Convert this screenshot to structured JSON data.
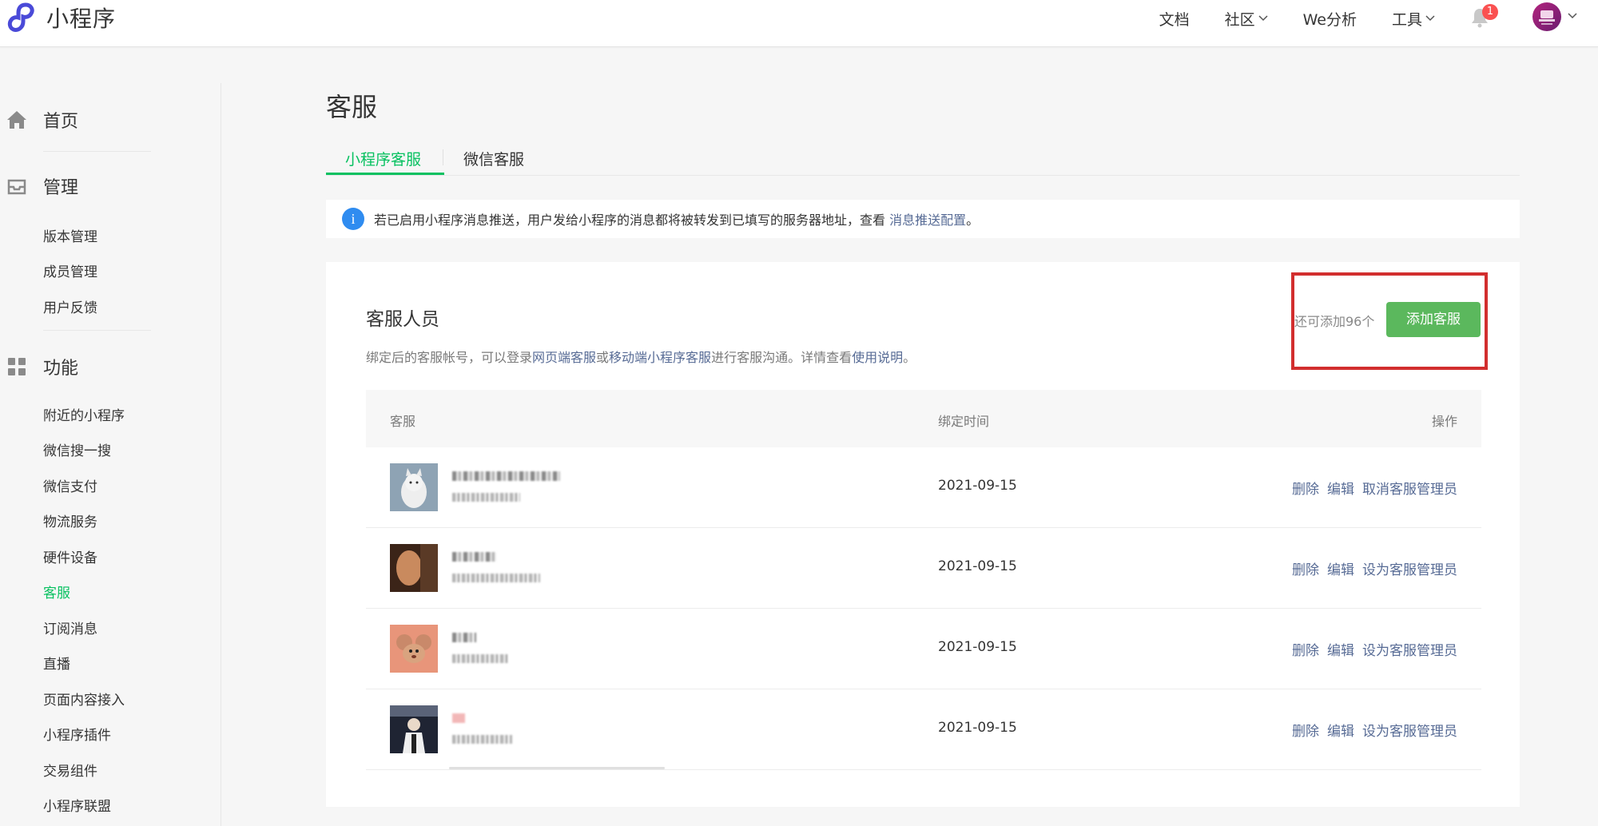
{
  "app": {
    "title": "小程序",
    "accent_color": "#07c160",
    "logo_icon": "miniprogram-logo-icon"
  },
  "topnav": {
    "items": [
      {
        "label": "文档",
        "has_dropdown": false
      },
      {
        "label": "社区",
        "has_dropdown": true
      },
      {
        "label": "We分析",
        "has_dropdown": false
      },
      {
        "label": "工具",
        "has_dropdown": true
      }
    ],
    "notification_count": "1",
    "bell_icon": "bell-icon",
    "avatar_icon": "user-avatar"
  },
  "sidebar": {
    "home": {
      "label": "首页",
      "icon": "home-icon"
    },
    "manage": {
      "label": "管理",
      "icon": "inbox-icon",
      "items": [
        "版本管理",
        "成员管理",
        "用户反馈"
      ]
    },
    "features": {
      "label": "功能",
      "icon": "grid-icon",
      "items": [
        "附近的小程序",
        "微信搜一搜",
        "微信支付",
        "物流服务",
        "硬件设备",
        "客服",
        "订阅消息",
        "直播",
        "页面内容接入",
        "小程序插件",
        "交易组件",
        "小程序联盟"
      ],
      "active": "客服"
    }
  },
  "page": {
    "title": "客服",
    "tabs": [
      {
        "label": "小程序客服",
        "active": true
      },
      {
        "label": "微信客服",
        "active": false
      }
    ],
    "notice": {
      "icon": "info-icon",
      "text": "若已启用小程序消息推送，用户发给小程序的消息都将被转发到已填写的服务器地址，查看 ",
      "link": "消息推送配置",
      "suffix": "。"
    },
    "card": {
      "title": "客服人员",
      "desc_prefix": "绑定后的客服帐号，可以登录",
      "desc_link1": "网页端客服",
      "desc_mid1": "或",
      "desc_link2": "移动端小程序客服",
      "desc_mid2": "进行客服沟通。详情查看",
      "desc_link3": "使用说明",
      "desc_suffix": "。",
      "quota": "还可添加96个",
      "add_button": "添加客服"
    },
    "table": {
      "headers": [
        "客服",
        "绑定时间",
        "操作"
      ],
      "rows": [
        {
          "avatar": "cat-avatar",
          "bind_time": "2021-09-15",
          "ops": [
            "删除",
            "编辑",
            "取消客服管理员"
          ]
        },
        {
          "avatar": "photo-avatar",
          "bind_time": "2021-09-15",
          "ops": [
            "删除",
            "编辑",
            "设为客服管理员"
          ]
        },
        {
          "avatar": "cartoon-mouse-avatar",
          "bind_time": "2021-09-15",
          "ops": [
            "删除",
            "编辑",
            "设为客服管理员"
          ]
        },
        {
          "avatar": "person-avatar",
          "bind_time": "2021-09-15",
          "ops": [
            "删除",
            "编辑",
            "设为客服管理员"
          ]
        }
      ]
    }
  }
}
